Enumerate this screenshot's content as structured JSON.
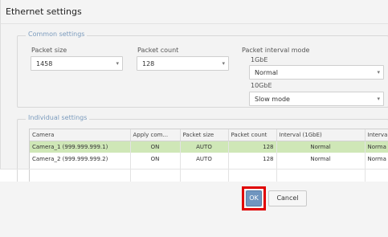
{
  "window": {
    "title": "Ethernet settings"
  },
  "common": {
    "legend": "Common settings",
    "packet_size": {
      "label": "Packet size",
      "value": "1458"
    },
    "packet_count": {
      "label": "Packet count",
      "value": "128"
    },
    "interval_mode": {
      "label": "Packet interval mode",
      "gbe1": {
        "label": "1GbE",
        "value": "Normal"
      },
      "gbe10": {
        "label": "10GbE",
        "value": "Slow mode"
      }
    }
  },
  "individual": {
    "legend": "Individual settings",
    "columns": [
      "Camera",
      "Apply com...",
      "Packet size",
      "Packet count",
      "Interval (1GbE)",
      "Interva"
    ],
    "rows": [
      {
        "camera": "Camera_1 (999.999.999.1)",
        "apply": "ON",
        "size": "AUTO",
        "count": "128",
        "interval": "Normal",
        "interval10": "Norma",
        "selected": true
      },
      {
        "camera": "Camera_2 (999.999.999.2)",
        "apply": "ON",
        "size": "AUTO",
        "count": "128",
        "interval": "Normal",
        "interval10": "Norma",
        "selected": false
      }
    ]
  },
  "footer": {
    "ok_label": "OK",
    "cancel_label": "Cancel"
  },
  "icons": {
    "dropdown": "chevron-down-icon"
  },
  "colors": {
    "selected_row": "#cfe7b7",
    "primary_button": "#6f95bf",
    "highlight": "#e00000",
    "legend": "#7b9bbd"
  }
}
